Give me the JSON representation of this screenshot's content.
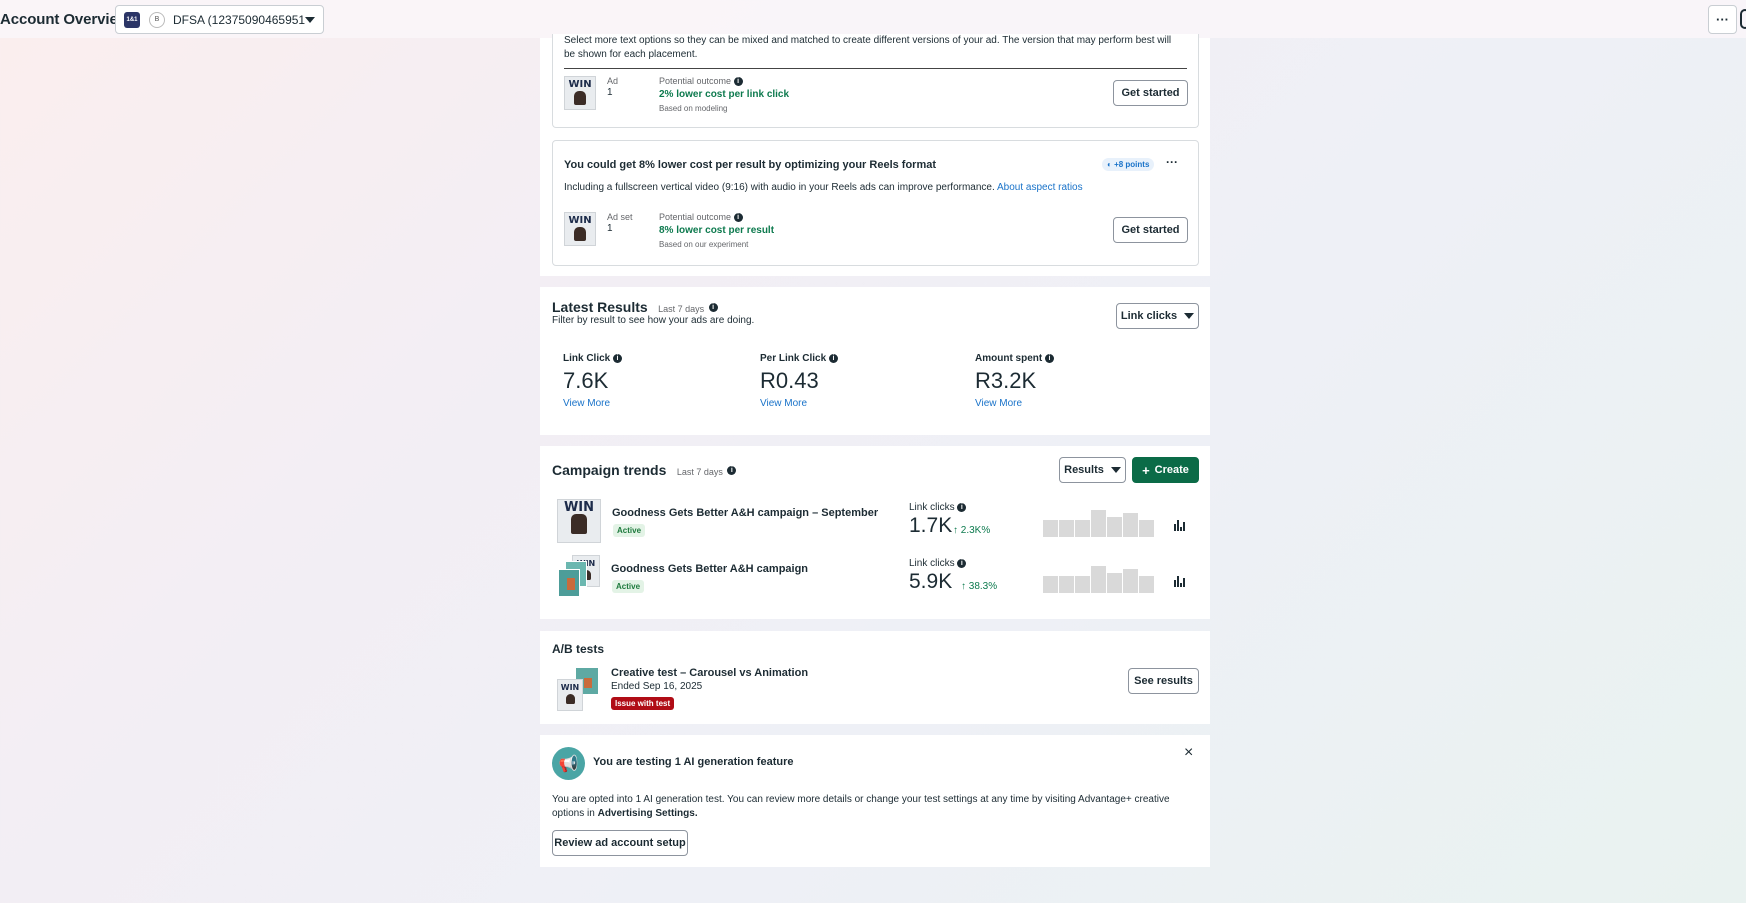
{
  "header": {
    "title": "Account Overview",
    "account": {
      "logo_text": "1&1",
      "badge_text": "B",
      "name": "DFSA (12375090465951..."
    },
    "more_label": "···"
  },
  "opportunities": {
    "text_card": {
      "description": "Select more text options so they can be mixed and matched to create different versions of your ad. The version that may perform best will be shown for each placement.",
      "level_label": "Ad",
      "level_count": "1",
      "outcome_label": "Potential outcome",
      "outcome_value": "2% lower cost per link click",
      "outcome_basis": "Based on modeling",
      "button": "Get started"
    },
    "reels_card": {
      "title": "You could get 8% lower cost per result by optimizing your Reels format",
      "points": "+8 points",
      "description": "Including a fullscreen vertical video (9:16) with audio in your Reels ads can improve performance.",
      "link": "About aspect ratios",
      "level_label": "Ad set",
      "level_count": "1",
      "outcome_label": "Potential outcome",
      "outcome_value": "8% lower cost per result",
      "outcome_basis": "Based on our experiment",
      "button": "Get started",
      "more": "···"
    }
  },
  "thumb": {
    "text": "WIN"
  },
  "latest_results": {
    "title": "Latest Results",
    "period": "Last 7 days",
    "subtitle": "Filter by result to see how your ads are doing.",
    "filter": "Link clicks",
    "metrics": [
      {
        "label": "Link Click",
        "value": "7.6K",
        "link": "View More"
      },
      {
        "label": "Per Link Click",
        "value": "R0.43",
        "link": "View More"
      },
      {
        "label": "Amount spent",
        "value": "R3.2K",
        "link": "View More"
      }
    ]
  },
  "campaign_trends": {
    "title": "Campaign trends",
    "period": "Last 7 days",
    "dropdown": "Results",
    "create": "Create",
    "campaigns": [
      {
        "name": "Goodness Gets Better A&H campaign – September",
        "status": "Active",
        "metric_label": "Link clicks",
        "metric_value": "1.7K",
        "change": "2.3K%",
        "bars": [
          0.55,
          0.55,
          0.55,
          0.9,
          0.65,
          0.8,
          0.55
        ]
      },
      {
        "name": "Goodness Gets Better A&H campaign",
        "status": "Active",
        "metric_label": "Link clicks",
        "metric_value": "5.9K",
        "change": "38.3%",
        "bars": [
          0.55,
          0.55,
          0.55,
          0.9,
          0.65,
          0.8,
          0.55
        ]
      }
    ]
  },
  "ab_tests": {
    "title": "A/B tests",
    "test_name": "Creative test – Carousel vs Animation",
    "ended": "Ended Sep 16, 2025",
    "issue": "Issue with test",
    "button": "See results"
  },
  "ai_feature": {
    "title": "You are testing 1 AI generation feature",
    "body": "You are opted into 1 AI generation test. You can review more details or change your test settings at any time by visiting Advantage+ creative options in",
    "body_bold": "Advertising Settings.",
    "button": "Review ad account setup",
    "close": "×"
  },
  "colors": {
    "accent_green": "#0d7a4e",
    "link_blue": "#1a73c9",
    "issue_red": "#b00c16"
  }
}
